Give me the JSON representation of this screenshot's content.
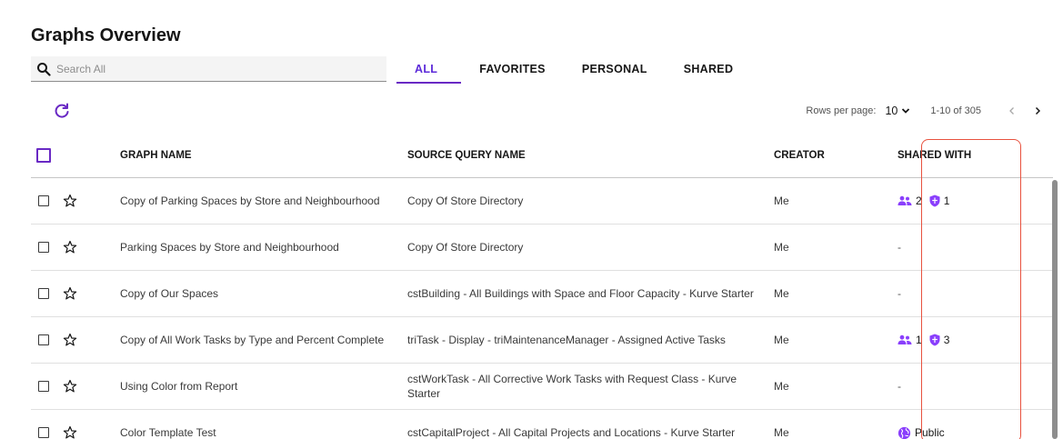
{
  "page": {
    "title": "Graphs Overview"
  },
  "search": {
    "placeholder": "Search All"
  },
  "tabs": [
    {
      "label": "ALL",
      "active": true
    },
    {
      "label": "FAVORITES",
      "active": false
    },
    {
      "label": "PERSONAL",
      "active": false
    },
    {
      "label": "SHARED",
      "active": false
    }
  ],
  "pager": {
    "rows_per_page_label": "Rows per page:",
    "rows_per_page_value": "10",
    "range_text": "1-10 of 305"
  },
  "table": {
    "headers": {
      "graph_name": "GRAPH NAME",
      "source_query_name": "SOURCE QUERY NAME",
      "creator": "CREATOR",
      "shared_with": "SHARED WITH"
    },
    "rows": [
      {
        "graph_name": "Copy of Parking Spaces by Store and Neighbourhood",
        "source_query_name": "Copy Of Store Directory",
        "creator": "Me",
        "shared": {
          "groups": "2",
          "roles": "1"
        }
      },
      {
        "graph_name": "Parking Spaces by Store and Neighbourhood",
        "source_query_name": "Copy Of Store Directory",
        "creator": "Me",
        "shared": {
          "none": "-"
        }
      },
      {
        "graph_name": "Copy of Our Spaces",
        "source_query_name": "cstBuilding - All Buildings with Space and Floor Capacity - Kurve Starter",
        "creator": "Me",
        "shared": {
          "none": "-"
        }
      },
      {
        "graph_name": "Copy of All Work Tasks by Type and Percent Complete",
        "source_query_name": "triTask - Display - triMaintenanceManager - Assigned Active Tasks",
        "creator": "Me",
        "shared": {
          "groups": "1",
          "roles": "3"
        }
      },
      {
        "graph_name": "Using Color from Report",
        "source_query_name": "cstWorkTask - All Corrective Work Tasks with Request Class - Kurve Starter",
        "creator": "Me",
        "shared": {
          "none": "-"
        }
      },
      {
        "graph_name": "Color Template Test",
        "source_query_name": "cstCapitalProject - All Capital Projects and Locations - Kurve Starter",
        "creator": "Me",
        "shared": {
          "public": "Public"
        }
      }
    ]
  },
  "colors": {
    "accent": "#6929c4",
    "highlight": "#e8523f",
    "shared_icon": "#8a3ffc"
  }
}
